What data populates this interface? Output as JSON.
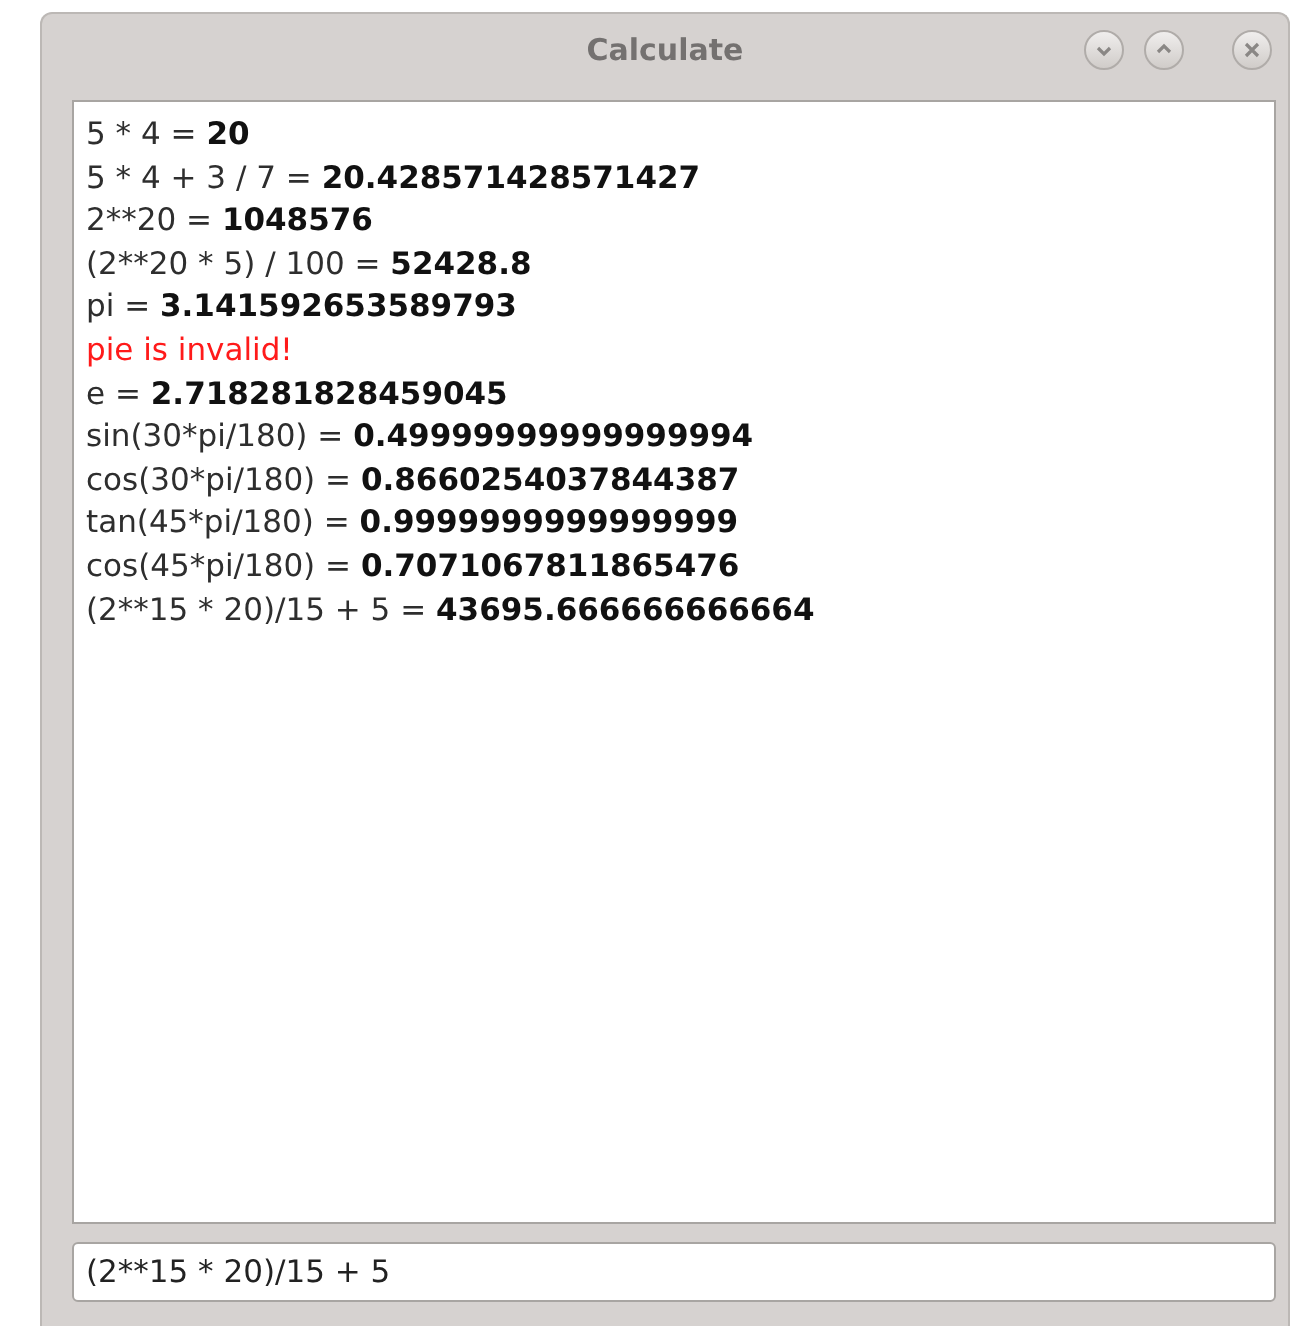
{
  "window": {
    "title": "Calculate"
  },
  "output": [
    {
      "kind": "result",
      "expression": "5 * 4 =",
      "value": "20"
    },
    {
      "kind": "result",
      "expression": "5 * 4 + 3 / 7 =",
      "value": "20.428571428571427"
    },
    {
      "kind": "result",
      "expression": "2**20 =",
      "value": "1048576"
    },
    {
      "kind": "result",
      "expression": "(2**20 * 5) / 100 =",
      "value": "52428.8"
    },
    {
      "kind": "result",
      "expression": "pi =",
      "value": "3.141592653589793"
    },
    {
      "kind": "error",
      "expression": "pie is invalid!"
    },
    {
      "kind": "result",
      "expression": "e =",
      "value": "2.718281828459045"
    },
    {
      "kind": "result",
      "expression": "sin(30*pi/180) =",
      "value": "0.49999999999999994"
    },
    {
      "kind": "result",
      "expression": "cos(30*pi/180) =",
      "value": "0.8660254037844387"
    },
    {
      "kind": "result",
      "expression": "tan(45*pi/180) =",
      "value": "0.9999999999999999"
    },
    {
      "kind": "result",
      "expression": "cos(45*pi/180) =",
      "value": "0.7071067811865476"
    },
    {
      "kind": "result",
      "expression": "(2**15 * 20)/15 + 5 =",
      "value": "43695.666666666664"
    }
  ],
  "input": {
    "value": "(2**15 * 20)/15 + 5"
  }
}
